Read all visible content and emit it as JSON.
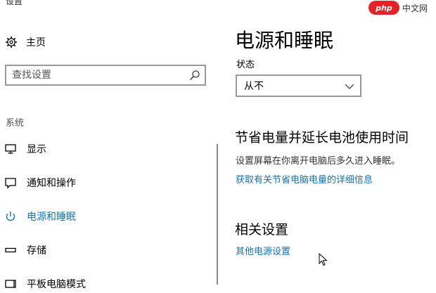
{
  "window": {
    "title": "设置"
  },
  "sidebar": {
    "home_label": "主页",
    "search": {
      "placeholder": "查找设置"
    },
    "section_label": "系统",
    "items": [
      {
        "label": "显示",
        "icon": "monitor-icon",
        "active": false
      },
      {
        "label": "通知和操作",
        "icon": "notification-icon",
        "active": false
      },
      {
        "label": "电源和睡眠",
        "icon": "power-icon",
        "active": true
      },
      {
        "label": "存储",
        "icon": "storage-icon",
        "active": false
      },
      {
        "label": "平板电脑模式",
        "icon": "tablet-mode-icon",
        "active": false
      }
    ]
  },
  "main": {
    "title": "电源和睡眠",
    "status_label": "状态",
    "status_dropdown": {
      "value": "从不"
    },
    "battery_section": {
      "title": "节省电量并延长电池使用时间",
      "description": "设置屏幕在你离开电脑后多久进入睡眠。",
      "link": "获取有关节省电脑电量的详细信息"
    },
    "related_section": {
      "title": "相关设置",
      "link": "其他电源设置"
    }
  },
  "watermark": {
    "logo": "php",
    "text": "中文网"
  },
  "colors": {
    "accent": "#1a73a8",
    "link": "#1a6fa8",
    "border": "#999999",
    "watermark_red": "#e0242a"
  }
}
